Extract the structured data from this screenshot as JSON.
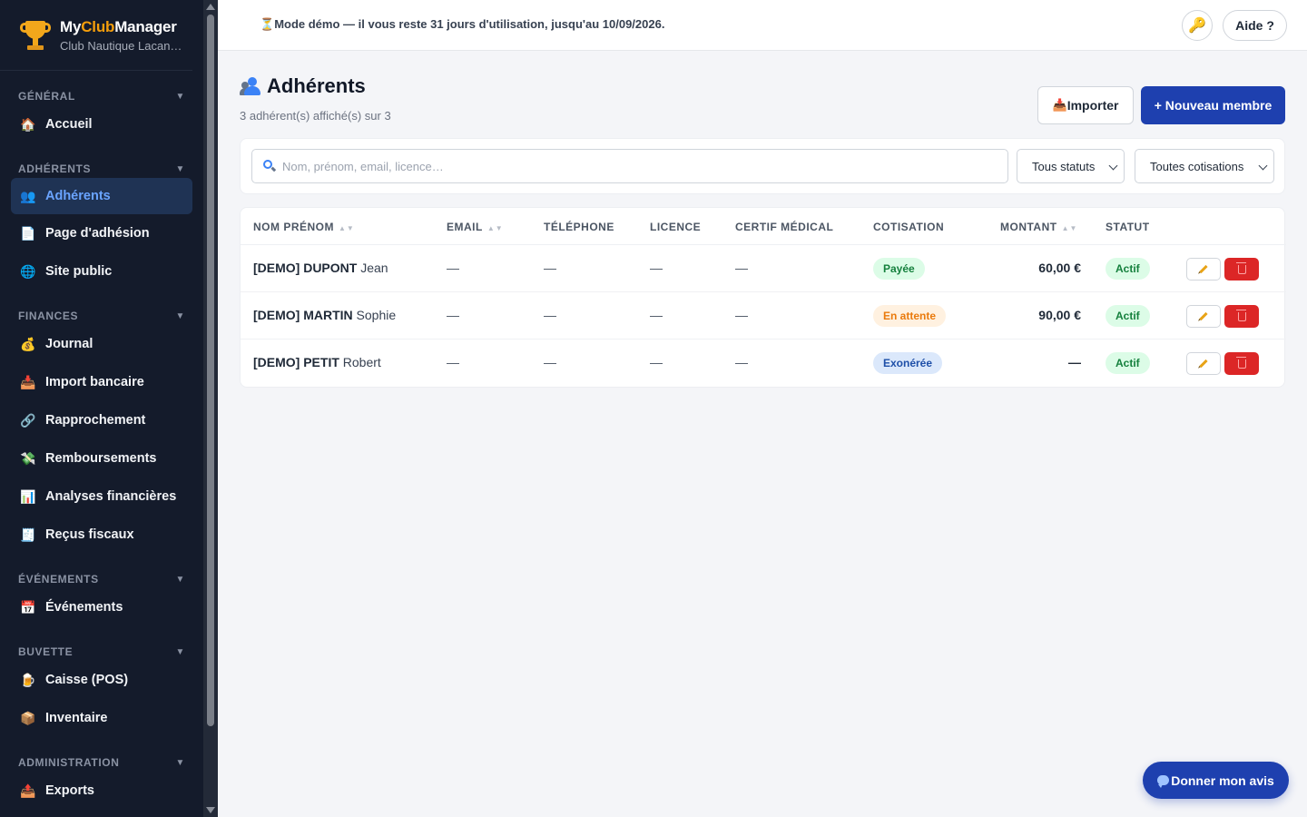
{
  "brand": {
    "name_part1": "My",
    "name_accent": "Club",
    "name_part2": "Manager",
    "club": "Club Nautique Lacan…"
  },
  "sidebar": {
    "sections": [
      {
        "title": "GÉNÉRAL",
        "items": [
          {
            "label": "Accueil",
            "icon": "house-icon"
          }
        ]
      },
      {
        "title": "ADHÉRENTS",
        "items": [
          {
            "label": "Adhérents",
            "icon": "users-icon",
            "active": true
          },
          {
            "label": "Page d'adhésion",
            "icon": "page-icon"
          },
          {
            "label": "Site public",
            "icon": "globe-icon"
          }
        ]
      },
      {
        "title": "FINANCES",
        "items": [
          {
            "label": "Journal",
            "icon": "money-bag-icon"
          },
          {
            "label": "Import bancaire",
            "icon": "inbox-download-icon"
          },
          {
            "label": "Rapprochement",
            "icon": "link-icon"
          },
          {
            "label": "Remboursements",
            "icon": "money-wings-icon"
          },
          {
            "label": "Analyses financières",
            "icon": "bar-chart-icon"
          },
          {
            "label": "Reçus fiscaux",
            "icon": "receipt-icon"
          }
        ]
      },
      {
        "title": "ÉVÉNEMENTS",
        "items": [
          {
            "label": "Événements",
            "icon": "calendar-icon"
          }
        ]
      },
      {
        "title": "BUVETTE",
        "items": [
          {
            "label": "Caisse (POS)",
            "icon": "beer-icon"
          },
          {
            "label": "Inventaire",
            "icon": "box-icon"
          }
        ]
      },
      {
        "title": "ADMINISTRATION",
        "items": [
          {
            "label": "Exports",
            "icon": "outbox-upload-icon"
          }
        ]
      }
    ]
  },
  "topbar": {
    "demo_notice": "Mode démo — il vous reste 31 jours d'utilisation, jusqu'au 10/09/2026.",
    "help_label": "Aide ?"
  },
  "main": {
    "title": "Adhérents",
    "subtitle": "3 adhérent(s) affiché(s) sur 3",
    "import_label": "Importer",
    "new_member_label": "+ Nouveau membre",
    "search_placeholder": "Nom, prénom, email, licence…",
    "status_filter": "Tous statuts",
    "cotisation_filter": "Toutes cotisations",
    "columns": {
      "name": "NOM PRÉNOM",
      "email": "EMAIL",
      "phone": "TÉLÉPHONE",
      "license": "LICENCE",
      "medical": "CERTIF MÉDICAL",
      "cotisation": "COTISATION",
      "amount": "MONTANT",
      "status": "STATUT"
    },
    "sort_glyph": "▲▼",
    "rows": [
      {
        "last": "[DEMO] DUPONT",
        "first": "Jean",
        "email": "—",
        "phone": "—",
        "license": "—",
        "medical": "—",
        "cotisation": "Payée",
        "cotisation_kind": "paid",
        "amount": "60,00 €",
        "status": "Actif"
      },
      {
        "last": "[DEMO] MARTIN",
        "first": "Sophie",
        "email": "—",
        "phone": "—",
        "license": "—",
        "medical": "—",
        "cotisation": "En attente",
        "cotisation_kind": "wait",
        "amount": "90,00 €",
        "status": "Actif"
      },
      {
        "last": "[DEMO] PETIT",
        "first": "Robert",
        "email": "—",
        "phone": "—",
        "license": "—",
        "medical": "—",
        "cotisation": "Exonérée",
        "cotisation_kind": "exo",
        "amount": "—",
        "status": "Actif"
      }
    ]
  },
  "feedback_label": "Donner mon avis",
  "colors": {
    "sidebar_bg": "#141b2b",
    "accent": "#1e40af",
    "brand_accent": "#f59e0b",
    "danger": "#dc2626"
  }
}
